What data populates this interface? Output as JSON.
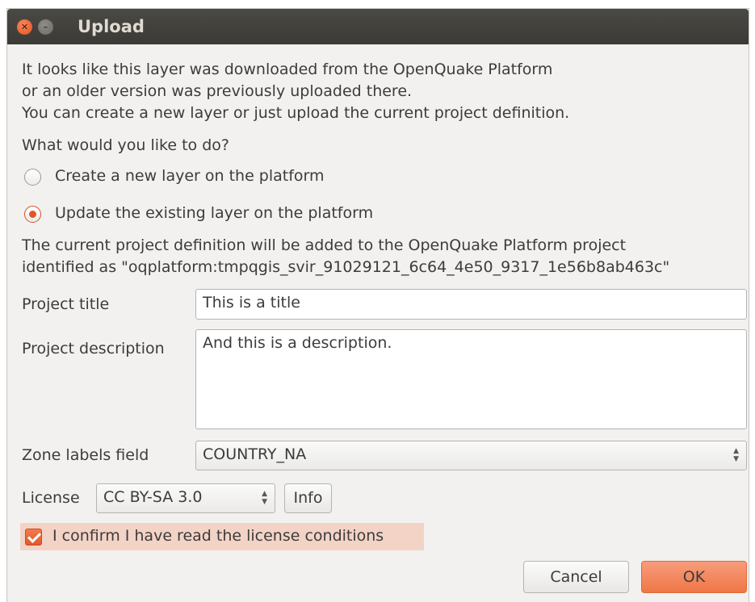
{
  "window": {
    "title": "Upload"
  },
  "intro": {
    "line1": "It looks like this layer was downloaded from the OpenQuake Platform",
    "line2": "or an older version was previously uploaded there.",
    "line3": "You can create a new layer or just upload the current project definition."
  },
  "question": "What would you like to do?",
  "options": [
    {
      "label": "Create a new layer on the platform",
      "checked": false
    },
    {
      "label": "Update the existing layer on the platform",
      "checked": true
    }
  ],
  "info_text": {
    "line1": "The current project definition will be added to the OpenQuake Platform project",
    "line2": "identified as \"oqplatform:tmpqgis_svir_91029121_6c64_4e50_9317_1e56b8ab463c\""
  },
  "form": {
    "title_label": "Project title",
    "title_value": "This is a title",
    "description_label": "Project description",
    "description_value": "And this is a description.",
    "zone_label": "Zone labels field",
    "zone_value": "COUNTRY_NA",
    "license_label": "License",
    "license_value": "CC BY-SA 3.0",
    "info_button": "Info"
  },
  "confirm": {
    "label": "I confirm I have read the license conditions",
    "checked": true
  },
  "buttons": {
    "cancel": "Cancel",
    "ok": "OK"
  },
  "colors": {
    "accent": "#f07746",
    "titlebar": "#3b3a36",
    "background": "#f2f1f0"
  },
  "icons": {
    "close": "close-icon",
    "minimize": "minimize-icon"
  }
}
